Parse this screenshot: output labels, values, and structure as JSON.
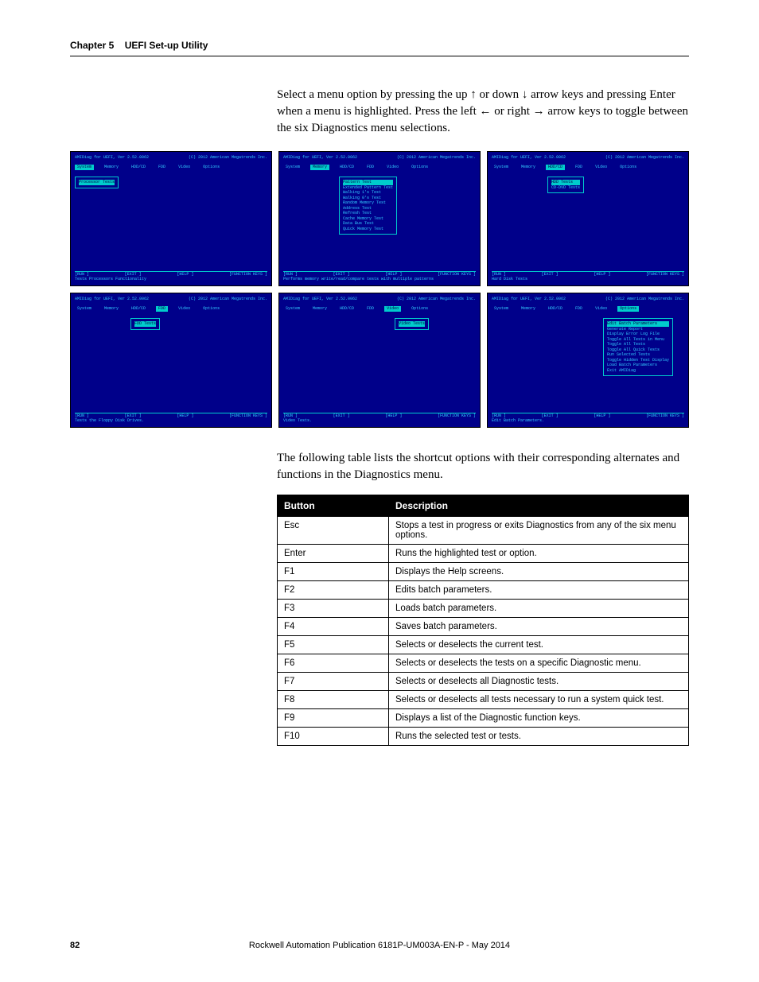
{
  "header": {
    "chapter": "Chapter 5",
    "section": "UEFI Set-up Utility"
  },
  "intro": "Select a menu option by pressing the up ↑ or down ↓ arrow keys and pressing Enter when a menu is highlighted. Press the left ← or right → arrow keys to toggle between the six Diagnostics menu selections.",
  "screens": {
    "title_left": "AMIDiag for UEFI, Ver 2.52.0062",
    "title_right": "(C) 2012 American Megatrends Inc.",
    "tabs": [
      "System",
      "Memory",
      "HDD/CD",
      "FDD",
      "Video",
      "Options"
    ],
    "s1": {
      "selected_tab": 0,
      "box_class": "",
      "items": [
        "Processor Tests"
      ],
      "status": "Tests Processors Functionality"
    },
    "s2": {
      "selected_tab": 1,
      "box_class": "scr-box-mid",
      "items": [
        "Pattern Test",
        "Extended Pattern Test",
        "Walking 1's Test",
        "Walking 0's Test",
        "Random Memory Test",
        "Address Test",
        "Refresh Test",
        "Cache Memory Test",
        "Data Bus Test",
        "Quick Memory Test"
      ],
      "status": "Performs memory write/read/compare tests with multiple patterns"
    },
    "s3": {
      "selected_tab": 2,
      "box_class": "scr-box-mid",
      "items": [
        "HDD Tests",
        "CD-DVD Tests"
      ],
      "status": "Hard Disk Tests"
    },
    "s4": {
      "selected_tab": 3,
      "box_class": "scr-box-mid",
      "items": [
        "FDD Tests"
      ],
      "status": "Tests the Floppy Disk Drives."
    },
    "s5": {
      "selected_tab": 4,
      "box_class": "scr-box-right",
      "items": [
        "Video Tests"
      ],
      "status": "Video Tests."
    },
    "s6": {
      "selected_tab": 5,
      "box_class": "scr-box-right",
      "items": [
        "Edit Batch Parameters",
        "Generate Report",
        "Display Error Log File",
        "Toggle All Tests in Menu",
        "Toggle All Tests",
        "Toggle All Quick Tests",
        "Run Selected Tests",
        "Toggle Hidden Test Display",
        "Load Batch Parameters",
        "Exit AMIDiag"
      ],
      "status": "Edit Batch Parameters."
    },
    "footer_keys": {
      "run": "[RUN <ENTER>]",
      "exit": "[EXIT <ESC>]",
      "help": "[HELP <F1>]",
      "fn": "[FUNCTION KEYS <F9>]"
    }
  },
  "table_intro": "The following table lists the shortcut options with their corresponding alternates and functions in the Diagnostics menu.",
  "table": {
    "headers": [
      "Button",
      "Description"
    ],
    "rows": [
      {
        "b": "Esc",
        "d": "Stops a test in progress or exits Diagnostics from any of the six menu options."
      },
      {
        "b": "Enter",
        "d": "Runs the highlighted test or option."
      },
      {
        "b": "F1",
        "d": "Displays the Help screens."
      },
      {
        "b": "F2",
        "d": "Edits batch parameters."
      },
      {
        "b": "F3",
        "d": "Loads batch parameters."
      },
      {
        "b": "F4",
        "d": "Saves batch parameters."
      },
      {
        "b": "F5",
        "d": "Selects or deselects the current test."
      },
      {
        "b": "F6",
        "d": "Selects or deselects the tests on a specific Diagnostic menu."
      },
      {
        "b": "F7",
        "d": "Selects or deselects all Diagnostic tests."
      },
      {
        "b": "F8",
        "d": "Selects or deselects all tests necessary to run a system quick test."
      },
      {
        "b": "F9",
        "d": "Displays a list of the Diagnostic function keys."
      },
      {
        "b": "F10",
        "d": "Runs the selected test or tests."
      }
    ]
  },
  "footer": {
    "page": "82",
    "pub": "Rockwell Automation Publication 6181P-UM003A-EN-P - May 2014"
  }
}
